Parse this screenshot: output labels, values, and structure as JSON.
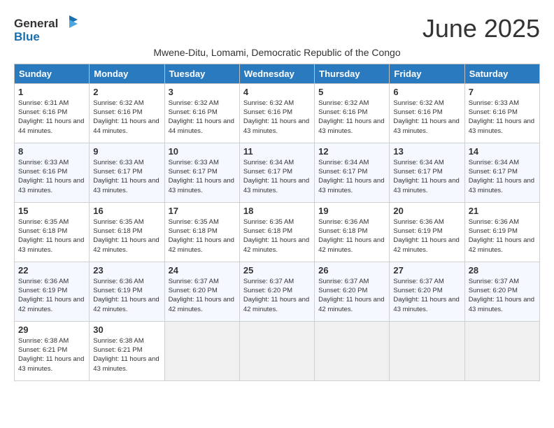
{
  "logo": {
    "general": "General",
    "blue": "Blue"
  },
  "title": "June 2025",
  "subtitle": "Mwene-Ditu, Lomami, Democratic Republic of the Congo",
  "headers": [
    "Sunday",
    "Monday",
    "Tuesday",
    "Wednesday",
    "Thursday",
    "Friday",
    "Saturday"
  ],
  "weeks": [
    [
      {
        "day": "1",
        "sunrise": "6:31 AM",
        "sunset": "6:16 PM",
        "daylight": "11 hours and 44 minutes."
      },
      {
        "day": "2",
        "sunrise": "6:32 AM",
        "sunset": "6:16 PM",
        "daylight": "11 hours and 44 minutes."
      },
      {
        "day": "3",
        "sunrise": "6:32 AM",
        "sunset": "6:16 PM",
        "daylight": "11 hours and 44 minutes."
      },
      {
        "day": "4",
        "sunrise": "6:32 AM",
        "sunset": "6:16 PM",
        "daylight": "11 hours and 43 minutes."
      },
      {
        "day": "5",
        "sunrise": "6:32 AM",
        "sunset": "6:16 PM",
        "daylight": "11 hours and 43 minutes."
      },
      {
        "day": "6",
        "sunrise": "6:32 AM",
        "sunset": "6:16 PM",
        "daylight": "11 hours and 43 minutes."
      },
      {
        "day": "7",
        "sunrise": "6:33 AM",
        "sunset": "6:16 PM",
        "daylight": "11 hours and 43 minutes."
      }
    ],
    [
      {
        "day": "8",
        "sunrise": "6:33 AM",
        "sunset": "6:16 PM",
        "daylight": "11 hours and 43 minutes."
      },
      {
        "day": "9",
        "sunrise": "6:33 AM",
        "sunset": "6:17 PM",
        "daylight": "11 hours and 43 minutes."
      },
      {
        "day": "10",
        "sunrise": "6:33 AM",
        "sunset": "6:17 PM",
        "daylight": "11 hours and 43 minutes."
      },
      {
        "day": "11",
        "sunrise": "6:34 AM",
        "sunset": "6:17 PM",
        "daylight": "11 hours and 43 minutes."
      },
      {
        "day": "12",
        "sunrise": "6:34 AM",
        "sunset": "6:17 PM",
        "daylight": "11 hours and 43 minutes."
      },
      {
        "day": "13",
        "sunrise": "6:34 AM",
        "sunset": "6:17 PM",
        "daylight": "11 hours and 43 minutes."
      },
      {
        "day": "14",
        "sunrise": "6:34 AM",
        "sunset": "6:17 PM",
        "daylight": "11 hours and 43 minutes."
      }
    ],
    [
      {
        "day": "15",
        "sunrise": "6:35 AM",
        "sunset": "6:18 PM",
        "daylight": "11 hours and 43 minutes."
      },
      {
        "day": "16",
        "sunrise": "6:35 AM",
        "sunset": "6:18 PM",
        "daylight": "11 hours and 42 minutes."
      },
      {
        "day": "17",
        "sunrise": "6:35 AM",
        "sunset": "6:18 PM",
        "daylight": "11 hours and 42 minutes."
      },
      {
        "day": "18",
        "sunrise": "6:35 AM",
        "sunset": "6:18 PM",
        "daylight": "11 hours and 42 minutes."
      },
      {
        "day": "19",
        "sunrise": "6:36 AM",
        "sunset": "6:18 PM",
        "daylight": "11 hours and 42 minutes."
      },
      {
        "day": "20",
        "sunrise": "6:36 AM",
        "sunset": "6:19 PM",
        "daylight": "11 hours and 42 minutes."
      },
      {
        "day": "21",
        "sunrise": "6:36 AM",
        "sunset": "6:19 PM",
        "daylight": "11 hours and 42 minutes."
      }
    ],
    [
      {
        "day": "22",
        "sunrise": "6:36 AM",
        "sunset": "6:19 PM",
        "daylight": "11 hours and 42 minutes."
      },
      {
        "day": "23",
        "sunrise": "6:36 AM",
        "sunset": "6:19 PM",
        "daylight": "11 hours and 42 minutes."
      },
      {
        "day": "24",
        "sunrise": "6:37 AM",
        "sunset": "6:20 PM",
        "daylight": "11 hours and 42 minutes."
      },
      {
        "day": "25",
        "sunrise": "6:37 AM",
        "sunset": "6:20 PM",
        "daylight": "11 hours and 42 minutes."
      },
      {
        "day": "26",
        "sunrise": "6:37 AM",
        "sunset": "6:20 PM",
        "daylight": "11 hours and 42 minutes."
      },
      {
        "day": "27",
        "sunrise": "6:37 AM",
        "sunset": "6:20 PM",
        "daylight": "11 hours and 43 minutes."
      },
      {
        "day": "28",
        "sunrise": "6:37 AM",
        "sunset": "6:20 PM",
        "daylight": "11 hours and 43 minutes."
      }
    ],
    [
      {
        "day": "29",
        "sunrise": "6:38 AM",
        "sunset": "6:21 PM",
        "daylight": "11 hours and 43 minutes."
      },
      {
        "day": "30",
        "sunrise": "6:38 AM",
        "sunset": "6:21 PM",
        "daylight": "11 hours and 43 minutes."
      },
      null,
      null,
      null,
      null,
      null
    ]
  ],
  "labels": {
    "sunrise": "Sunrise: ",
    "sunset": "Sunset: ",
    "daylight": "Daylight: "
  }
}
